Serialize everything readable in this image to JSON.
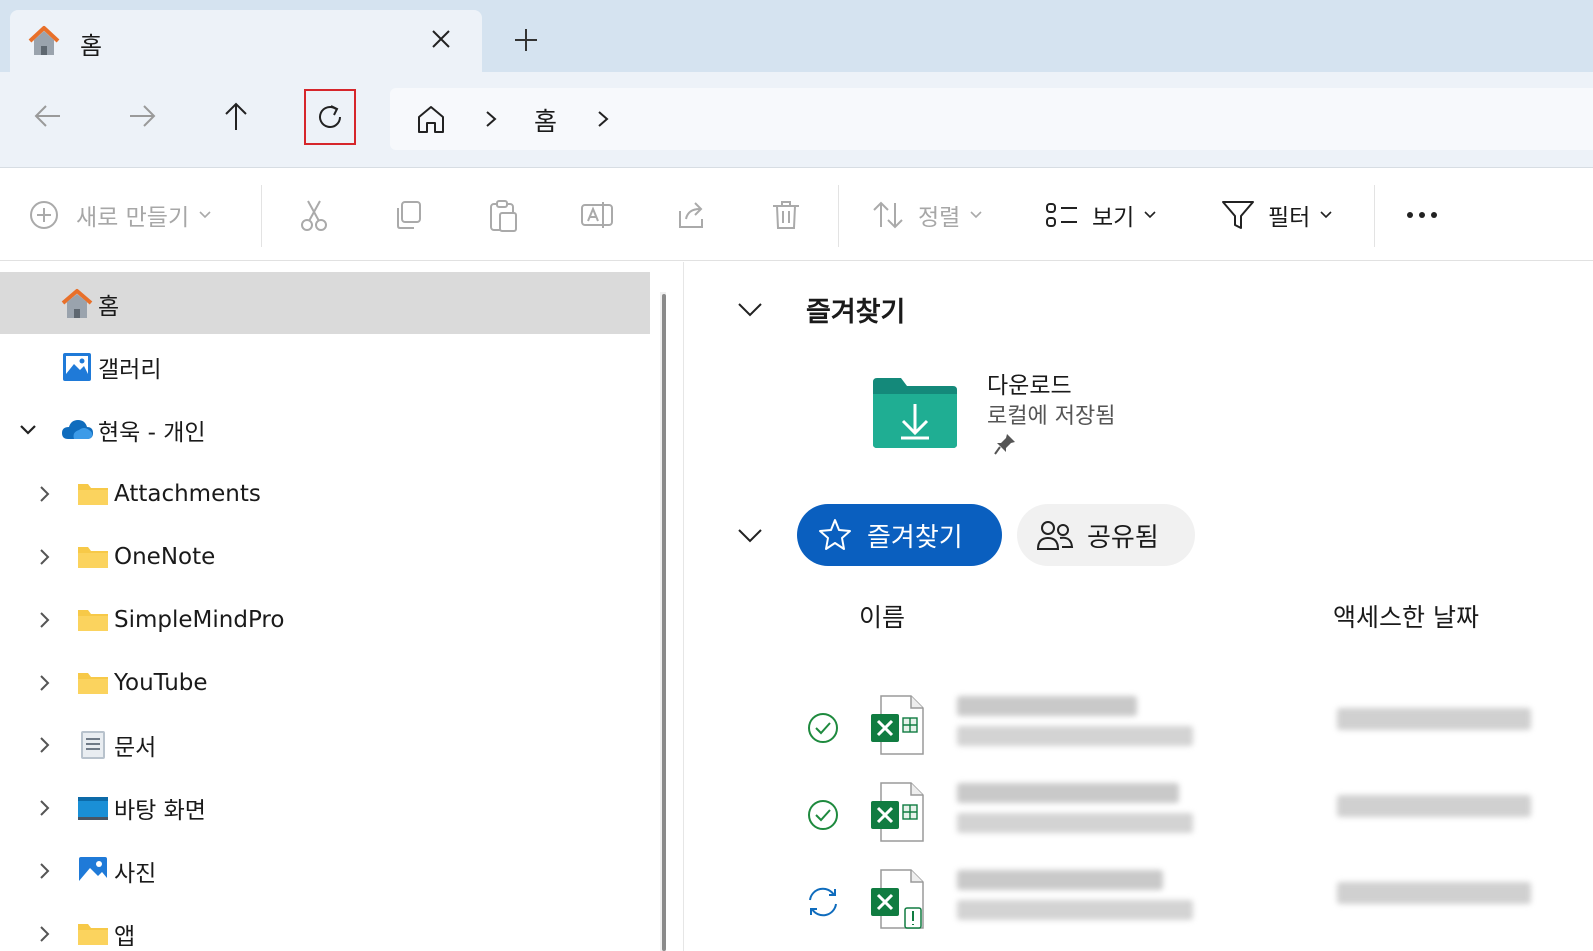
{
  "tab": {
    "title": "홈",
    "icon": "home-icon"
  },
  "nav": {
    "back_icon": "arrow-left-icon",
    "forward_icon": "arrow-right-icon",
    "up_icon": "arrow-up-icon",
    "refresh_icon": "refresh-icon",
    "breadcrumb": [
      "홈"
    ]
  },
  "toolbar": {
    "new_label": "새로 만들기",
    "sort_label": "정렬",
    "view_label": "보기",
    "filter_label": "필터",
    "more_icon": "more-icon"
  },
  "sidebar": {
    "items": [
      {
        "label": "홈",
        "icon": "home-icon",
        "selected": true
      },
      {
        "label": "갤러리",
        "icon": "gallery-icon"
      },
      {
        "label": "현욱 - 개인",
        "icon": "onedrive-cloud-icon",
        "expanded": true
      },
      {
        "label": "Attachments",
        "icon": "folder-icon"
      },
      {
        "label": "OneNote",
        "icon": "folder-icon"
      },
      {
        "label": "SimpleMindPro",
        "icon": "folder-icon"
      },
      {
        "label": "YouTube",
        "icon": "folder-icon"
      },
      {
        "label": "문서",
        "icon": "documents-icon"
      },
      {
        "label": "바탕 화면",
        "icon": "desktop-icon"
      },
      {
        "label": "사진",
        "icon": "pictures-icon"
      },
      {
        "label": "앱",
        "icon": "folder-icon"
      }
    ]
  },
  "main": {
    "quick_access_title": "즐겨찾기",
    "quick_items": [
      {
        "name": "다운로드",
        "sub": "로컬에 저장됨",
        "icon": "downloads-folder-icon",
        "pinned": true
      }
    ],
    "filter_tabs": [
      {
        "label": "즐겨찾기",
        "active": true,
        "icon": "star-icon"
      },
      {
        "label": "공유됨",
        "active": false,
        "icon": "people-icon"
      }
    ],
    "columns": {
      "name": "이름",
      "date": "액세스한 날짜"
    },
    "rows": [
      {
        "status_icon": "synced-check-icon",
        "file_icon": "excel-icon"
      },
      {
        "status_icon": "synced-check-icon",
        "file_icon": "excel-icon"
      },
      {
        "status_icon": "syncing-icon",
        "file_icon": "excel-icon"
      }
    ]
  },
  "colors": {
    "tabstrip": "#d5e3f0",
    "navrow": "#edf2f8",
    "accent": "#0a5fbf",
    "selection": "#dadada",
    "highlight_box": "#d6262b",
    "folder": "#f7c948",
    "excel_green": "#107c41"
  }
}
